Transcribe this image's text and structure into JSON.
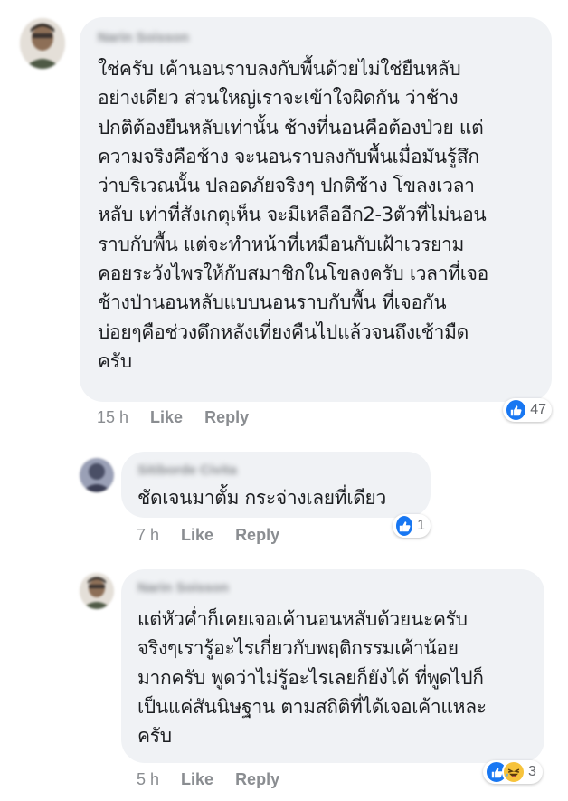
{
  "comments": [
    {
      "author": "Narin Soisson",
      "lines": [
        "ใช่ครับ เค้านอนราบลงกับพื้นด้วยไม่ใช่ยืนหลับ",
        "อย่างเดียว ส่วนใหญ่เราจะเข้าใจผิดกัน ว่าช้าง",
        "ปกติต้องยืนหลับเท่านั้น ช้างที่นอนคือต้องป่วย แต่",
        "ความจริงคือช้าง จะนอนราบลงกับพื้นเมื่อมันรู้สึก",
        "ว่าบริเวณนั้น ปลอดภัยจริงๆ ปกติช้าง โขลงเวลา",
        "หลับ เท่าที่สังเกตุเห็น จะมีเหลืออีก2-3ตัวที่ไม่นอน",
        "ราบกับพื้น แต่จะทำหน้าที่เหมือนกับเฝ้าเวรยาม",
        "คอยระวังไพรให้กับสมาชิกในโขลงครับ เวลาที่เจอ",
        "ช้างป่านอนหลับแบบนอนราบกับพื้น ที่เจอกัน",
        "บ่อยๆคือช่วงดึกหลังเที่ยงคืนไปแล้วจนถึงเช้ามืด",
        "ครับ"
      ],
      "time": "15 h",
      "like_label": "Like",
      "reply_label": "Reply",
      "reaction_count": "47",
      "reactions": [
        "like-icon"
      ]
    },
    {
      "author": "Sitiborde Civita",
      "lines": [
        "ชัดเจนมาตั้ม กระจ่างเลยที่เดียว"
      ],
      "time": "7 h",
      "like_label": "Like",
      "reply_label": "Reply",
      "reaction_count": "1",
      "reactions": [
        "like-icon"
      ]
    },
    {
      "author": "Narin Soisson",
      "lines": [
        "แต่หัวค่ำก็เคยเจอเค้านอนหลับด้วยนะครับ",
        "จริงๆเรารู้อะไรเกี่ยวกับพฤติกรรมเค้าน้อย",
        "มากครับ พูดว่าไม่รู้อะไรเลยก็ยังได้ ที่พูดไปก็",
        "เป็นแค่สันนิษฐาน ตามสถิติที่ได้เจอเค้าแหละ",
        "ครับ"
      ],
      "time": "5 h",
      "like_label": "Like",
      "reply_label": "Reply",
      "reaction_count": "3",
      "reactions": [
        "like-icon",
        "haha-icon"
      ]
    }
  ],
  "colors": {
    "bubble": "#f0f2f5",
    "meta_text": "#8a8d91",
    "like_blue": "#1877f2",
    "haha_yellow": "#f7c33b"
  }
}
